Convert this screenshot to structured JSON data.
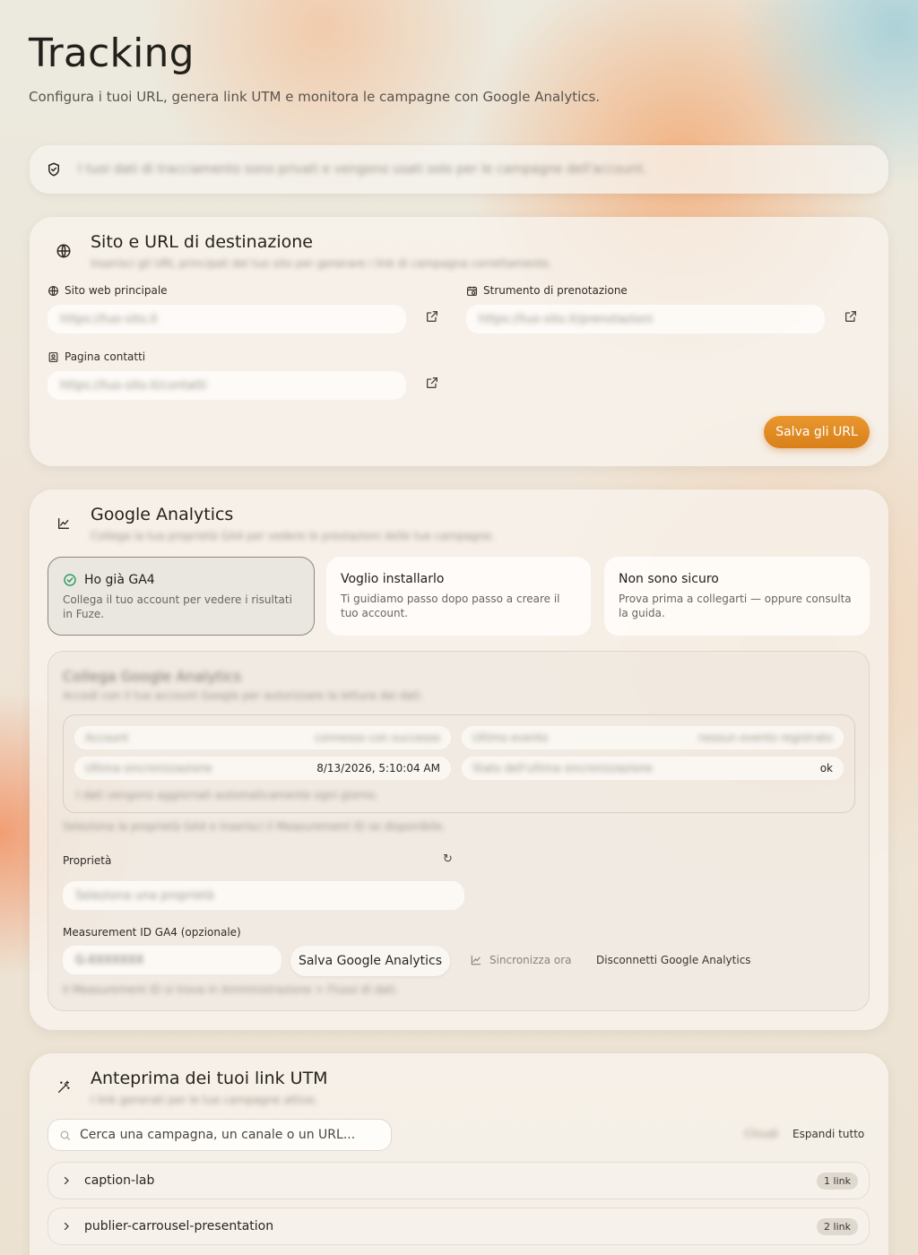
{
  "header": {
    "title": "Tracking",
    "subtitle": "Configura i tuoi URL, genera link UTM e monitora le campagne con Google Analytics."
  },
  "notice": {
    "icon": "shield-check-icon",
    "text": "I tuoi dati di tracciamento sono privati e vengono usati solo per le campagne dell'account."
  },
  "urls_section": {
    "icon": "globe-icon",
    "title": "Sito e URL di destinazione",
    "description": "Inserisci gli URL principali del tuo sito per generare i link di campagna correttamente.",
    "fields": [
      {
        "label": "Sito web principale",
        "icon": "globe-icon",
        "placeholder": "https://tuo-sito.it"
      },
      {
        "label": "Strumento di prenotazione",
        "icon": "calendar-clock-icon",
        "placeholder": "https://tuo-sito.it/prenotazioni"
      },
      {
        "label": "Pagina contatti",
        "icon": "contact-card-icon",
        "placeholder": "https://tuo-sito.it/contatti"
      }
    ],
    "save_label": "Salva gli URL"
  },
  "ga_section": {
    "icon": "line-chart-icon",
    "title": "Google Analytics",
    "description": "Collega la tua proprietà GA4 per vedere le prestazioni delle tue campagne.",
    "options": [
      {
        "title": "Ho già GA4",
        "description": "Collega il tuo account per vedere i risultati in Fuze.",
        "selected": true
      },
      {
        "title": "Voglio installarlo",
        "description": "Ti guidiamo passo dopo passo a creare il tuo account.",
        "selected": false
      },
      {
        "title": "Non sono sicuro",
        "description": "Prova prima a collegarti — oppure consulta la guida.",
        "selected": false
      }
    ],
    "connection": {
      "title": "Collega Google Analytics",
      "description": "Accedi con il tuo account Google per autorizzare la lettura dei dati.",
      "stats": [
        {
          "key": "Account",
          "value": "connesso con successo"
        },
        {
          "key": "Ultimo evento",
          "value": "nessun evento registrato"
        },
        {
          "key": "Ultima sincronizzazione",
          "value": "8/13/2026, 5:10:04 AM"
        },
        {
          "key": "Stato dell'ultima sincronizzazione",
          "value": "ok"
        }
      ],
      "stats_note": "I dati vengono aggiornati automaticamente ogni giorno.",
      "note": "Seleziona la proprietà GA4 e inserisci il Measurement ID se disponibile.",
      "property_label": "Proprietà",
      "refresh_symbol": "↻",
      "property_placeholder": "Seleziona una proprietà",
      "measurement_label": "Measurement ID GA4 (opzionale)",
      "measurement_placeholder": "G-XXXXXXX",
      "save_label": "Salva Google Analytics",
      "sync_label": "Sincronizza ora",
      "disconnect_label": "Disconnetti Google Analytics",
      "footer_note": "Il Measurement ID si trova in Amministrazione > Flussi di dati."
    }
  },
  "utm_section": {
    "icon": "magic-wand-icon",
    "title": "Anteprima dei tuoi link UTM",
    "description": "I link generati per le tue campagne attive.",
    "search_placeholder": "Cerca una campagna, un canale o un URL...",
    "collapse_label": "Chiudi",
    "expand_label": "Espandi tutto",
    "campaigns": [
      {
        "name": "caption-lab",
        "count": "1 link"
      },
      {
        "name": "publier-carrousel-presentation",
        "count": "2 link"
      }
    ]
  },
  "colors": {
    "accent": "#E08A24",
    "success": "#2E9E62",
    "text": "#2A2622"
  }
}
